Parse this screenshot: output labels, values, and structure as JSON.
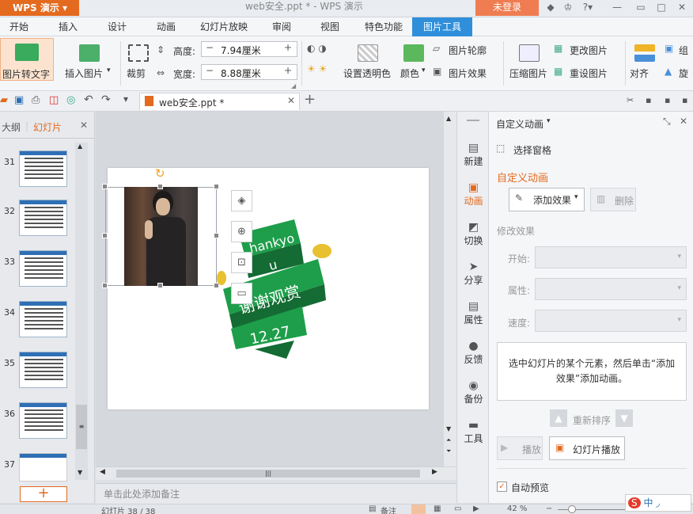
{
  "app": {
    "name": "WPS 演示",
    "title": "web安全.ppt * - WPS 演示",
    "login": "未登录"
  },
  "menu": [
    "开始",
    "插入",
    "设计",
    "动画",
    "幻灯片放映",
    "审阅",
    "视图",
    "特色功能",
    "图片工具"
  ],
  "ribbon": {
    "pic2text": "图片转文字",
    "insertpic": "插入图片",
    "crop": "裁剪",
    "height_label": "高度:",
    "height_value": "7.94厘米",
    "width_label": "宽度:",
    "width_value": "8.88厘米",
    "transparent": "设置透明色",
    "color": "颜色",
    "outline": "图片轮廓",
    "effect": "图片效果",
    "compress": "压缩图片",
    "change": "更改图片",
    "reset": "重设图片",
    "align": "对齐",
    "group": "组",
    "rotate": "旋"
  },
  "doc_tab": "web安全.ppt *",
  "left_panel": {
    "tab_outline": "大纲",
    "tab_slides": "幻灯片",
    "slides": [
      "31",
      "32",
      "33",
      "34",
      "35",
      "36",
      "37"
    ]
  },
  "slide": {
    "ribbon_text1": "hankyo",
    "ribbon_text2": "u",
    "ribbon_text3": "谢谢观赏",
    "ribbon_text4": "12.27",
    "green": "#1e9e4a",
    "darkgreen": "#146b33"
  },
  "notes_placeholder": "单击此处添加备注",
  "sidebar": [
    {
      "icon": "new-icon",
      "label": "新建"
    },
    {
      "icon": "animation-icon",
      "label": "动画"
    },
    {
      "icon": "switch-icon",
      "label": "切换"
    },
    {
      "icon": "share-icon",
      "label": "分享"
    },
    {
      "icon": "property-icon",
      "label": "属性"
    },
    {
      "icon": "feedback-icon",
      "label": "反馈"
    },
    {
      "icon": "backup-icon",
      "label": "备份"
    },
    {
      "icon": "tools-icon",
      "label": "工具"
    }
  ],
  "panel": {
    "header": "自定义动画",
    "select_pane": "选择窗格",
    "title": "自定义动画",
    "add_effect": "添加效果",
    "delete": "删除",
    "modify_effect": "修改效果",
    "start": "开始:",
    "property": "属性:",
    "speed": "速度:",
    "hint": "选中幻灯片的某个元素，然后单击“添加效果”添加动画。",
    "reorder": "重新排序",
    "play": "播放",
    "slideshow": "幻灯片播放",
    "autopreview": "自动预览"
  },
  "status": {
    "slide": "幻灯片 38 / 38",
    "notes": "备注",
    "zoom": "42 %"
  }
}
